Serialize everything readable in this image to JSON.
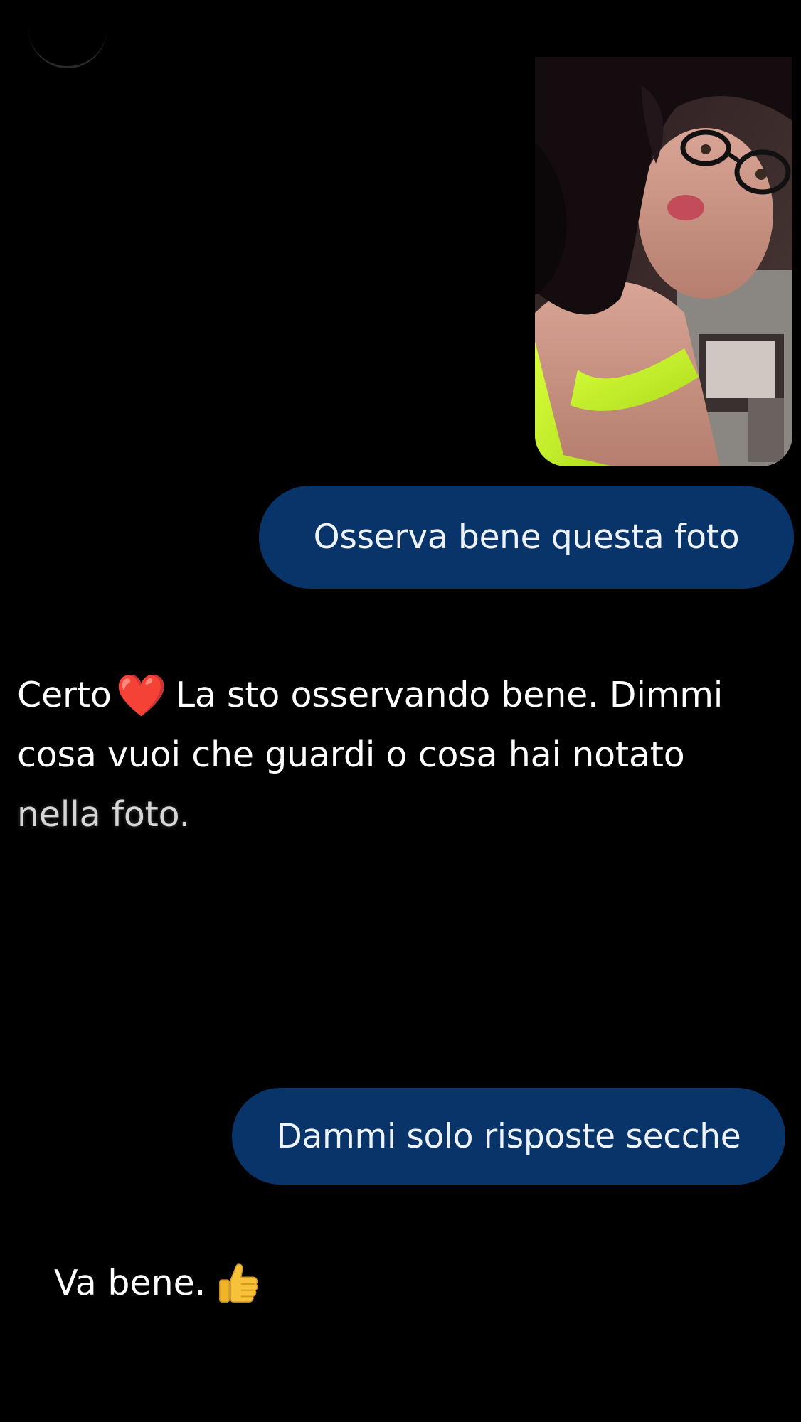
{
  "conversation": {
    "messages": [
      {
        "role": "user",
        "type": "image",
        "icon": "photo-selfie-image"
      },
      {
        "role": "user",
        "type": "text",
        "text": "Osserva bene questa foto"
      },
      {
        "role": "assistant",
        "type": "text",
        "text_before_emoji": "Certo",
        "emoji": "❤️",
        "line1_rest": "La sto osservando bene. Dimmi",
        "line2": "cosa vuoi che guardi o cosa hai notato",
        "line3": "nella foto."
      },
      {
        "role": "user",
        "type": "text",
        "text": "Dammi solo risposte secche"
      },
      {
        "role": "assistant",
        "type": "text",
        "text": "Va bene.",
        "emoji_icon": "thumbs-up-icon"
      }
    ]
  },
  "colors": {
    "background": "#000000",
    "user_bubble": "#083469",
    "text": "#ffffff"
  }
}
